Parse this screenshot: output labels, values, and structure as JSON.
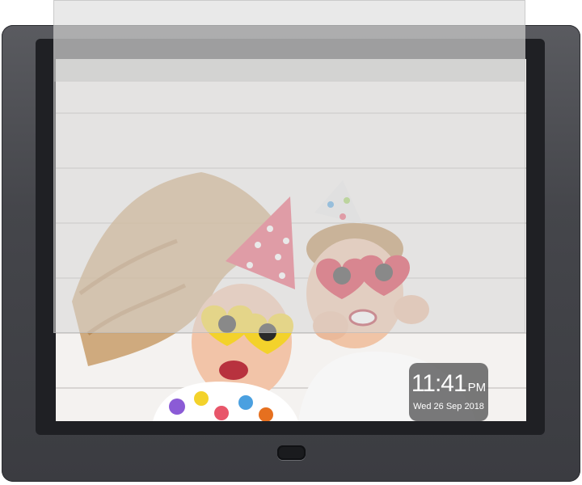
{
  "device": {
    "type": "digital-photo-frame",
    "frame_color": "#44454a",
    "power_button_icon": "power-button"
  },
  "photo": {
    "subject": "children-party-photo"
  },
  "clock_widget": {
    "time": "11:41",
    "meridiem": "PM",
    "date": "Wed 26 Sep 2018"
  },
  "colors": {
    "party_hat_pink": "#e8566a",
    "hat_dots": "#ffffff",
    "heart_glasses_red": "#d9243a",
    "heart_glasses_yellow": "#f3d22b",
    "hair_color": "#c89e6a"
  }
}
